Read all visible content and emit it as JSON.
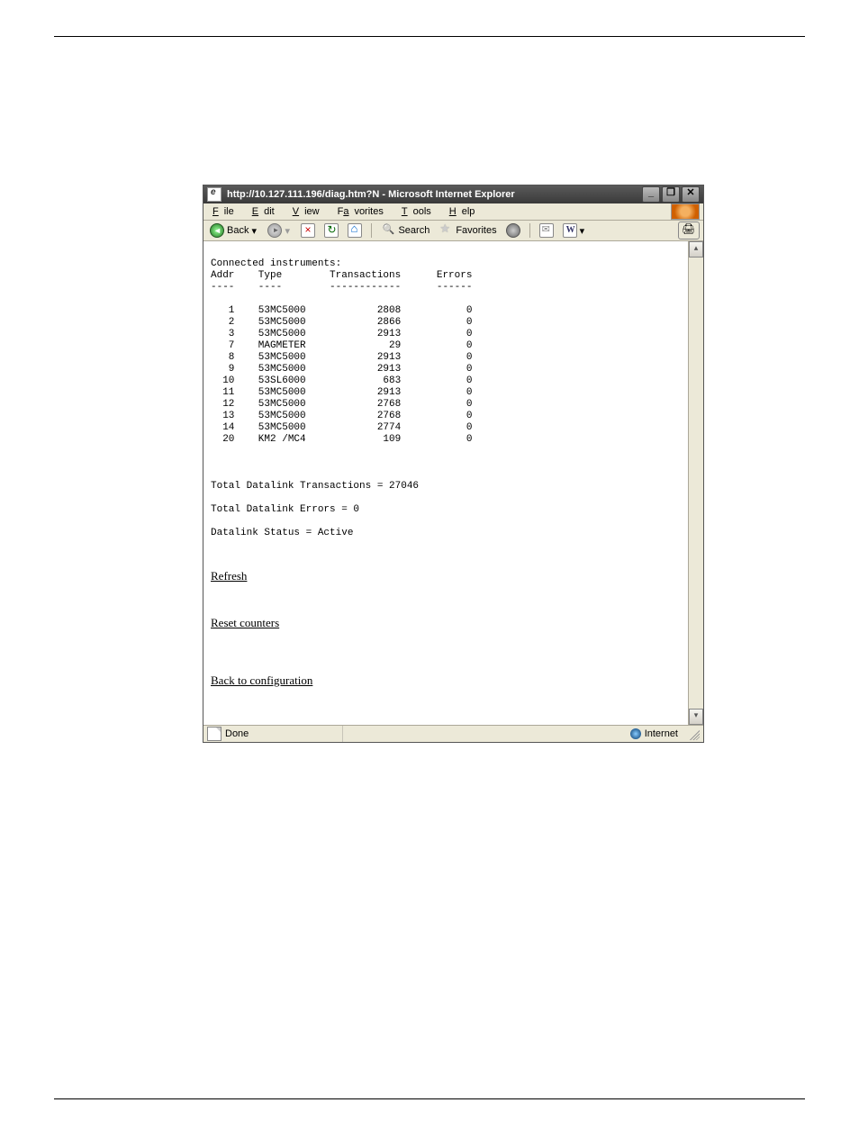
{
  "window": {
    "title": "http://10.127.111.196/diag.htm?N - Microsoft Internet Explorer"
  },
  "menus": {
    "file": "File",
    "edit": "Edit",
    "view": "View",
    "favorites": "Favorites",
    "tools": "Tools",
    "help": "Help"
  },
  "toolbar": {
    "back": "Back",
    "search": "Search",
    "favorites": "Favorites"
  },
  "page": {
    "heading": "Connected instruments:",
    "headers": {
      "addr": "Addr",
      "type": "Type",
      "transactions": "Transactions",
      "errors": "Errors"
    },
    "rows": [
      {
        "addr": "1",
        "type": "53MC5000",
        "transactions": "2808",
        "errors": "0"
      },
      {
        "addr": "2",
        "type": "53MC5000",
        "transactions": "2866",
        "errors": "0"
      },
      {
        "addr": "3",
        "type": "53MC5000",
        "transactions": "2913",
        "errors": "0"
      },
      {
        "addr": "7",
        "type": "MAGMETER",
        "transactions": "29",
        "errors": "0"
      },
      {
        "addr": "8",
        "type": "53MC5000",
        "transactions": "2913",
        "errors": "0"
      },
      {
        "addr": "9",
        "type": "53MC5000",
        "transactions": "2913",
        "errors": "0"
      },
      {
        "addr": "10",
        "type": "53SL6000",
        "transactions": "683",
        "errors": "0"
      },
      {
        "addr": "11",
        "type": "53MC5000",
        "transactions": "2913",
        "errors": "0"
      },
      {
        "addr": "12",
        "type": "53MC5000",
        "transactions": "2768",
        "errors": "0"
      },
      {
        "addr": "13",
        "type": "53MC5000",
        "transactions": "2768",
        "errors": "0"
      },
      {
        "addr": "14",
        "type": "53MC5000",
        "transactions": "2774",
        "errors": "0"
      },
      {
        "addr": "20",
        "type": "KM2 /MC4",
        "transactions": "109",
        "errors": "0"
      }
    ],
    "totals": {
      "transactions": "Total Datalink Transactions = 27046",
      "errors": "Total Datalink Errors = 0",
      "status": "Datalink Status = Active"
    },
    "links": {
      "refresh": "Refresh",
      "reset": "Reset counters",
      "back": "Back to configuration"
    }
  },
  "status": {
    "done": "Done",
    "zone": "Internet"
  }
}
